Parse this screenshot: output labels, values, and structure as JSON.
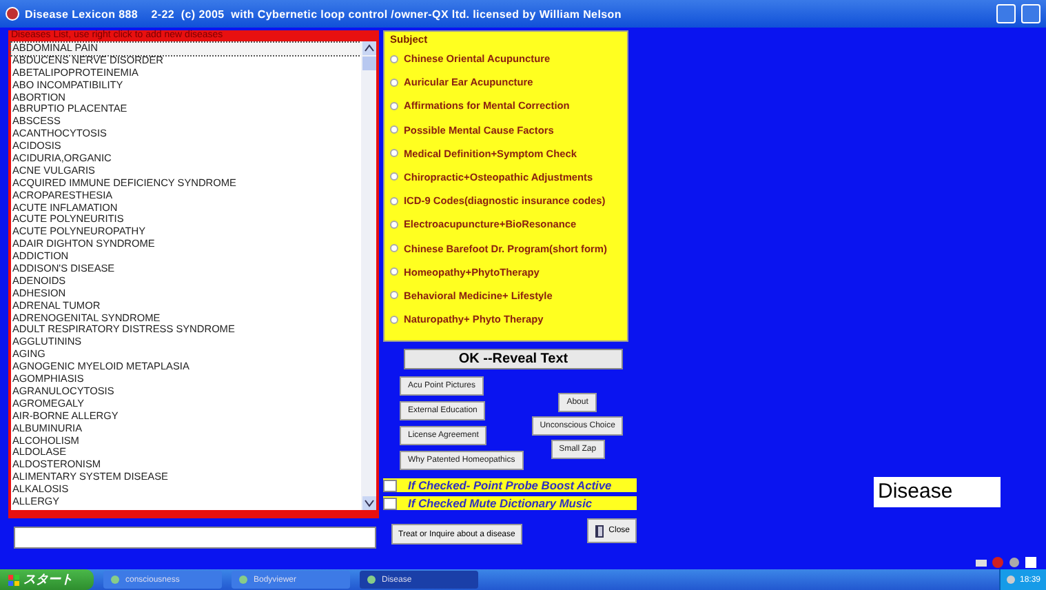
{
  "window": {
    "title": "Disease Lexicon 888    2-22  (c) 2005  with Cybernetic loop control /owner-QX ltd. licensed by William Nelson"
  },
  "disease_list": {
    "header": "Diseases List, use right click to add new diseases",
    "items": [
      {
        "label": "ABDOMINAL PAIN",
        "selected": true
      },
      {
        "label": "ABDUCENS NERVE DISORDER",
        "selected": false
      },
      {
        "label": "ABETALIPOPROTEINEMIA",
        "selected": false
      },
      {
        "label": "ABO INCOMPATIBILITY",
        "selected": false
      },
      {
        "label": "ABORTION",
        "selected": false
      },
      {
        "label": "ABRUPTIO PLACENTAE",
        "selected": false
      },
      {
        "label": "ABSCESS",
        "selected": false
      },
      {
        "label": "ACANTHOCYTOSIS",
        "selected": false
      },
      {
        "label": "ACIDOSIS",
        "selected": false
      },
      {
        "label": "ACIDURIA,ORGANIC",
        "selected": false
      },
      {
        "label": "ACNE VULGARIS",
        "selected": false
      },
      {
        "label": "ACQUIRED IMMUNE DEFICIENCY SYNDROME",
        "selected": false
      },
      {
        "label": "ACROPARESTHESIA",
        "selected": false
      },
      {
        "label": "ACUTE INFLAMATION",
        "selected": false
      },
      {
        "label": "ACUTE POLYNEURITIS",
        "selected": false
      },
      {
        "label": "ACUTE POLYNEUROPATHY",
        "selected": false
      },
      {
        "label": "ADAIR DIGHTON SYNDROME",
        "selected": false
      },
      {
        "label": "ADDICTION",
        "selected": false
      },
      {
        "label": "ADDISON'S DISEASE",
        "selected": false
      },
      {
        "label": "ADENOIDS",
        "selected": false
      },
      {
        "label": "ADHESION",
        "selected": false
      },
      {
        "label": "ADRENAL TUMOR",
        "selected": false
      },
      {
        "label": "ADRENOGENITAL SYNDROME",
        "selected": false
      },
      {
        "label": "ADULT RESPIRATORY DISTRESS SYNDROME",
        "selected": false
      },
      {
        "label": "AGGLUTININS",
        "selected": false
      },
      {
        "label": "AGING",
        "selected": false
      },
      {
        "label": "AGNOGENIC MYELOID METAPLASIA",
        "selected": false
      },
      {
        "label": "AGOMPHIASIS",
        "selected": false
      },
      {
        "label": "AGRANULOCYTOSIS",
        "selected": false
      },
      {
        "label": "AGROMEGALY",
        "selected": false
      },
      {
        "label": "AIR-BORNE ALLERGY",
        "selected": false
      },
      {
        "label": "ALBUMINURIA",
        "selected": false
      },
      {
        "label": "ALCOHOLISM",
        "selected": false
      },
      {
        "label": "ALDOLASE",
        "selected": false
      },
      {
        "label": "ALDOSTERONISM",
        "selected": false
      },
      {
        "label": "ALIMENTARY SYSTEM DISEASE",
        "selected": false
      },
      {
        "label": "ALKALOSIS",
        "selected": false
      },
      {
        "label": "ALLERGY",
        "selected": false
      }
    ]
  },
  "subject": {
    "title": "Subject",
    "options": [
      {
        "label": "Chinese Oriental Acupuncture",
        "selected": false
      },
      {
        "label": "Auricular Ear Acupuncture",
        "selected": false
      },
      {
        "label": "Affirmations for Mental Correction",
        "selected": false
      },
      {
        "label": "Possible Mental Cause Factors",
        "selected": false
      },
      {
        "label": "Medical Definition+Symptom Check",
        "selected": false
      },
      {
        "label": "Chiropractic+Osteopathic Adjustments",
        "selected": false
      },
      {
        "label": "ICD-9 Codes(diagnostic insurance codes)",
        "selected": false
      },
      {
        "label": "Electroacupuncture+BioResonance",
        "selected": false
      },
      {
        "label": "Chinese Barefoot Dr. Program(short form)",
        "selected": false
      },
      {
        "label": "Homeopathy+PhytoTherapy",
        "selected": false
      },
      {
        "label": "Behavioral Medicine+ Lifestyle",
        "selected": false
      },
      {
        "label": "Naturopathy+ Phyto Therapy",
        "selected": false
      }
    ]
  },
  "ok_button": "OK --Reveal Text",
  "left_buttons": [
    "Acu Point Pictures",
    "External Education",
    "License Agreement",
    "Why Patented Homeopathics"
  ],
  "right_buttons": [
    "About",
    "Unconscious Choice",
    "Small Zap"
  ],
  "checkboxes": [
    {
      "label": "If Checked- Point Probe Boost Active",
      "checked": false
    },
    {
      "label": "If Checked Mute Dictionary Music",
      "checked": false
    }
  ],
  "treat_button": "Treat or Inquire about a disease",
  "close_button": "Close",
  "disease_label": "Disease",
  "taskbar": {
    "start": "スタート",
    "tasks": [
      {
        "label": "consciousness",
        "selected": false
      },
      {
        "label": "Bodyviewer",
        "selected": false
      },
      {
        "label": "Disease",
        "selected": true
      }
    ],
    "clock": "18:39"
  }
}
